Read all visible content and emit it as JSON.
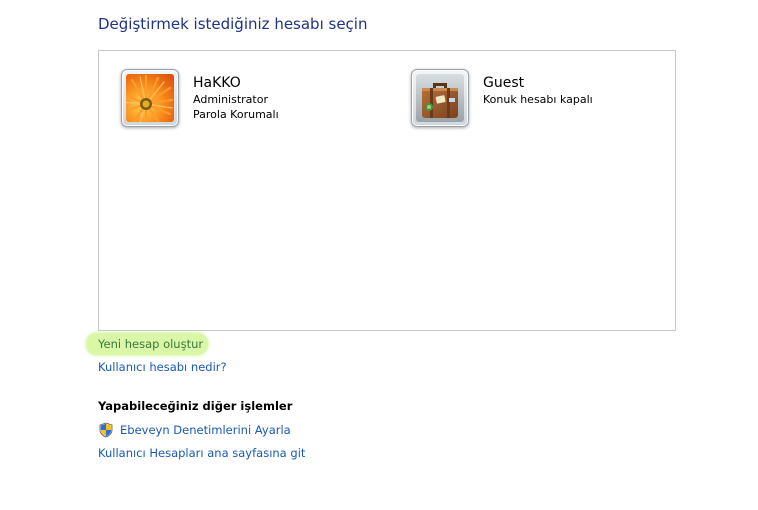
{
  "page_title": "Değiştirmek istediğiniz hesabı seçin",
  "accounts": [
    {
      "name": "HaKKO",
      "lines": [
        "Administrator",
        "Parola Korumalı"
      ],
      "avatar": "flower-avatar-icon"
    },
    {
      "name": "Guest",
      "lines": [
        "Konuk hesabı kapalı"
      ],
      "avatar": "suitcase-avatar-icon"
    }
  ],
  "links": {
    "new_account": "Yeni hesap oluştur",
    "what_is_account": "Kullanıcı hesabı nedir?"
  },
  "other_tasks": {
    "heading": "Yapabileceğiniz diğer işlemler",
    "parental_controls": "Ebeveyn Denetimlerini Ayarla",
    "parental_icon": "uac-shield-icon",
    "accounts_home": "Kullanıcı Hesapları ana sayfasına git"
  },
  "colors": {
    "title": "#1e3287",
    "link": "#1a5ab4",
    "highlight": "#d9f7a6"
  }
}
